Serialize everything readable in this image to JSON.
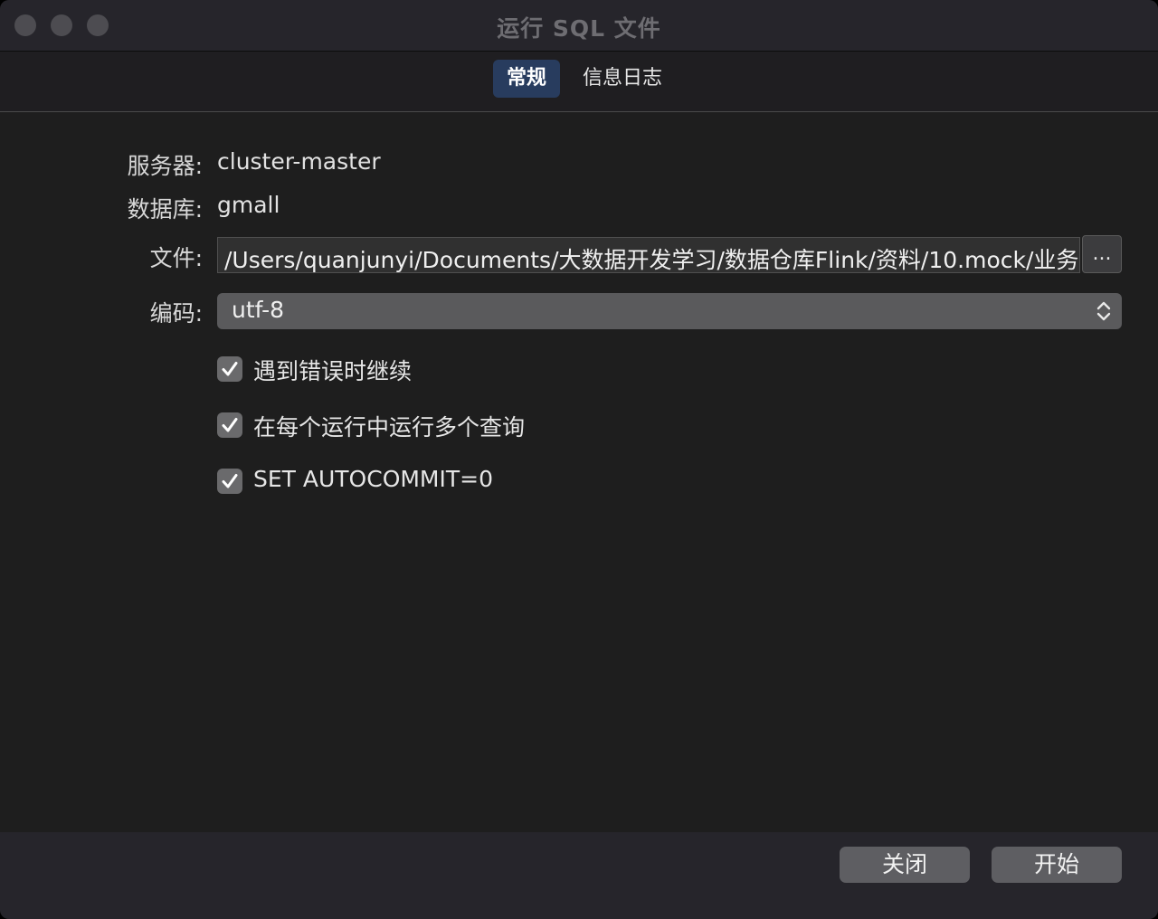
{
  "window": {
    "title": "运行 SQL 文件"
  },
  "tabs": [
    {
      "label": "常规",
      "selected": true
    },
    {
      "label": "信息日志",
      "selected": false
    }
  ],
  "form": {
    "server_label": "服务器:",
    "server_value": "cluster-master",
    "database_label": "数据库:",
    "database_value": "gmall",
    "file_label": "文件:",
    "file_value": "/Users/quanjunyi/Documents/大数据开发学习/数据仓库Flink/资料/10.mock/业务",
    "browse_label": "...",
    "encoding_label": "编码:",
    "encoding_value": "utf-8"
  },
  "options": [
    {
      "label": "遇到错误时继续",
      "checked": true
    },
    {
      "label": "在每个运行中运行多个查询",
      "checked": true
    },
    {
      "label": "SET AUTOCOMMIT=0",
      "checked": true
    }
  ],
  "footer": {
    "close_label": "关闭",
    "start_label": "开始"
  },
  "colors": {
    "tab_selected": "#283c5e",
    "window_bg": "#1e1e1e"
  }
}
